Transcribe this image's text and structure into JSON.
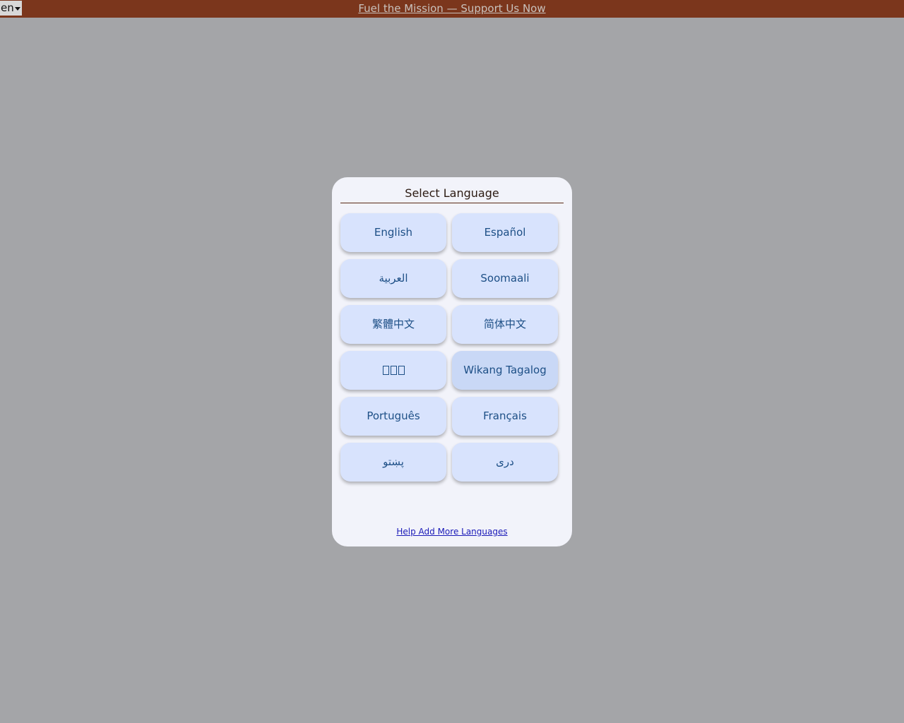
{
  "topbar": {
    "language_select_value": "en",
    "support_link": "Fuel the Mission — Support Us Now"
  },
  "modal": {
    "title": "Select Language",
    "languages": [
      {
        "label": "English"
      },
      {
        "label": "Español"
      },
      {
        "label": "العربية"
      },
      {
        "label": "Soomaali"
      },
      {
        "label": "繁體中文"
      },
      {
        "label": "简体中文"
      },
      {
        "label": "",
        "icon": "unrendered-glyphs-icon"
      },
      {
        "label": "Wikang Tagalog"
      },
      {
        "label": "Português"
      },
      {
        "label": "Français"
      },
      {
        "label": "پښتو"
      },
      {
        "label": "دری"
      }
    ],
    "help_link": "Help Add More Languages"
  },
  "colors": {
    "topbar": "#7b361c",
    "background": "#a4a5a8",
    "modal": "#f2f3fa",
    "button": "#d8e3fd",
    "button_text": "#1d4f86",
    "link": "#1a1ab8"
  }
}
